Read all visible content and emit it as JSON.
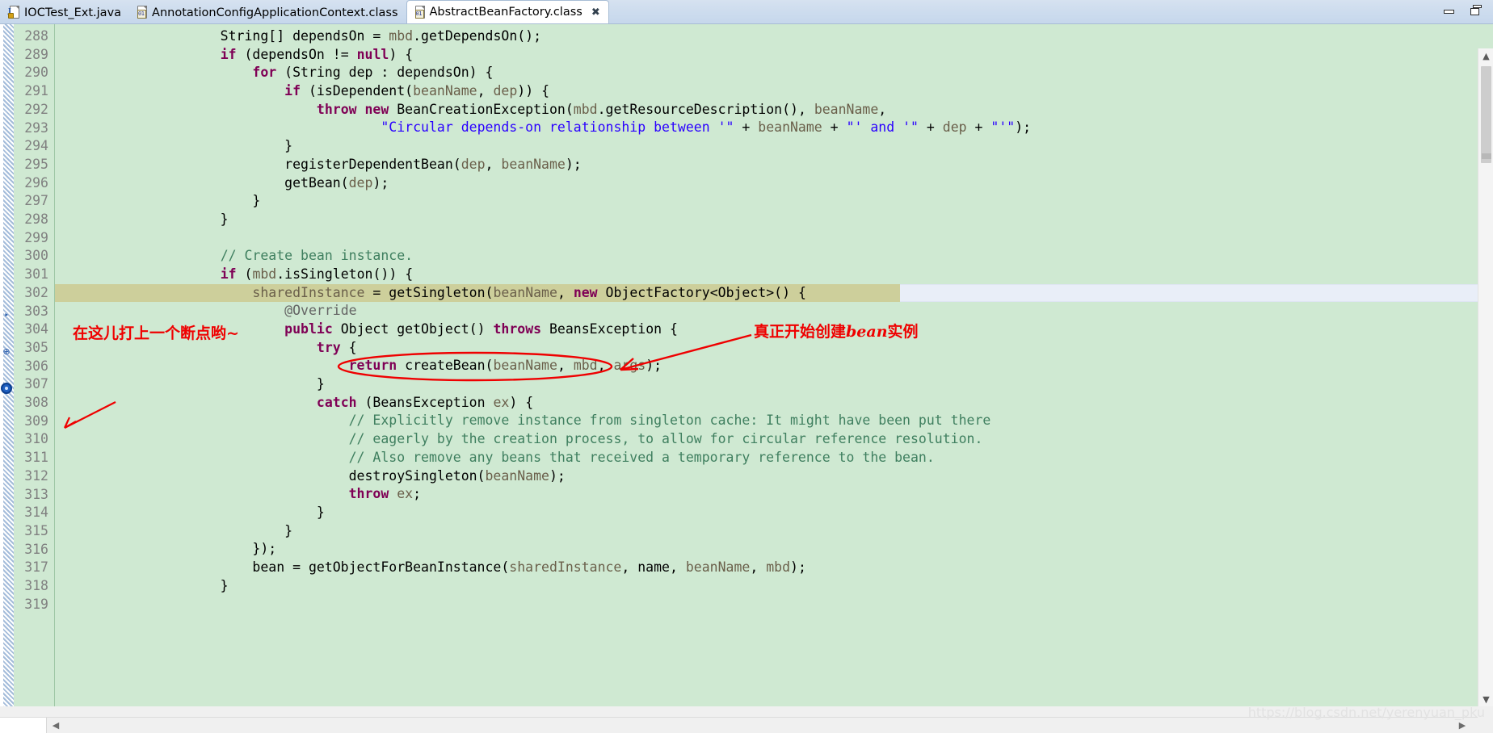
{
  "window": {
    "minimize_label": "Minimize",
    "restore_label": "Restore"
  },
  "tabs": [
    {
      "label": "IOCTest_Ext.java",
      "icon": "java-file-icon",
      "active": false,
      "closable": false
    },
    {
      "label": "AnnotationConfigApplicationContext.class",
      "icon": "class-file-icon",
      "active": false,
      "closable": false
    },
    {
      "label": "AbstractBeanFactory.class",
      "icon": "class-file-icon",
      "active": true,
      "closable": true,
      "close_glyph": "✖"
    }
  ],
  "editor": {
    "first_line_number": 288,
    "current_line": 302,
    "breakpoint_line": 306,
    "lines": [
      {
        "n": 288,
        "tokens": [
          {
            "t": "pln",
            "s": "                    String[] dependsOn = "
          },
          {
            "t": "var",
            "s": "mbd"
          },
          {
            "t": "pln",
            "s": ".getDependsOn();"
          }
        ]
      },
      {
        "n": 289,
        "tokens": [
          {
            "t": "pln",
            "s": "                    "
          },
          {
            "t": "kw",
            "s": "if"
          },
          {
            "t": "pln",
            "s": " (dependsOn != "
          },
          {
            "t": "kw",
            "s": "null"
          },
          {
            "t": "pln",
            "s": ") {"
          }
        ]
      },
      {
        "n": 290,
        "tokens": [
          {
            "t": "pln",
            "s": "                        "
          },
          {
            "t": "kw",
            "s": "for"
          },
          {
            "t": "pln",
            "s": " (String dep : dependsOn) {"
          }
        ]
      },
      {
        "n": 291,
        "tokens": [
          {
            "t": "pln",
            "s": "                            "
          },
          {
            "t": "kw",
            "s": "if"
          },
          {
            "t": "pln",
            "s": " (isDependent("
          },
          {
            "t": "par",
            "s": "beanName"
          },
          {
            "t": "pln",
            "s": ", "
          },
          {
            "t": "par",
            "s": "dep"
          },
          {
            "t": "pln",
            "s": ")) {"
          }
        ]
      },
      {
        "n": 292,
        "tokens": [
          {
            "t": "pln",
            "s": "                                "
          },
          {
            "t": "kw",
            "s": "throw new"
          },
          {
            "t": "pln",
            "s": " BeanCreationException("
          },
          {
            "t": "par",
            "s": "mbd"
          },
          {
            "t": "pln",
            "s": ".getResourceDescription(), "
          },
          {
            "t": "par",
            "s": "beanName"
          },
          {
            "t": "pln",
            "s": ","
          }
        ]
      },
      {
        "n": 293,
        "tokens": [
          {
            "t": "pln",
            "s": "                                        "
          },
          {
            "t": "str",
            "s": "\"Circular depends-on relationship between '\""
          },
          {
            "t": "pln",
            "s": " + "
          },
          {
            "t": "par",
            "s": "beanName"
          },
          {
            "t": "pln",
            "s": " + "
          },
          {
            "t": "str",
            "s": "\"' and '\""
          },
          {
            "t": "pln",
            "s": " + "
          },
          {
            "t": "par",
            "s": "dep"
          },
          {
            "t": "pln",
            "s": " + "
          },
          {
            "t": "str",
            "s": "\"'\""
          },
          {
            "t": "pln",
            "s": ");"
          }
        ]
      },
      {
        "n": 294,
        "tokens": [
          {
            "t": "pln",
            "s": "                            }"
          }
        ]
      },
      {
        "n": 295,
        "tokens": [
          {
            "t": "pln",
            "s": "                            registerDependentBean("
          },
          {
            "t": "par",
            "s": "dep"
          },
          {
            "t": "pln",
            "s": ", "
          },
          {
            "t": "par",
            "s": "beanName"
          },
          {
            "t": "pln",
            "s": ");"
          }
        ]
      },
      {
        "n": 296,
        "tokens": [
          {
            "t": "pln",
            "s": "                            getBean("
          },
          {
            "t": "par",
            "s": "dep"
          },
          {
            "t": "pln",
            "s": ");"
          }
        ]
      },
      {
        "n": 297,
        "tokens": [
          {
            "t": "pln",
            "s": "                        }"
          }
        ]
      },
      {
        "n": 298,
        "tokens": [
          {
            "t": "pln",
            "s": "                    }"
          }
        ]
      },
      {
        "n": 299,
        "tokens": [
          {
            "t": "pln",
            "s": ""
          }
        ]
      },
      {
        "n": 300,
        "tokens": [
          {
            "t": "pln",
            "s": "                    "
          },
          {
            "t": "cmt",
            "s": "// Create bean instance."
          }
        ]
      },
      {
        "n": 301,
        "tokens": [
          {
            "t": "pln",
            "s": "                    "
          },
          {
            "t": "kw",
            "s": "if"
          },
          {
            "t": "pln",
            "s": " ("
          },
          {
            "t": "par",
            "s": "mbd"
          },
          {
            "t": "pln",
            "s": ".isSingleton()) {"
          }
        ]
      },
      {
        "n": 302,
        "tokens": [
          {
            "t": "pln",
            "s": "                        "
          },
          {
            "t": "par",
            "s": "sharedInstance"
          },
          {
            "t": "pln",
            "s": " = getSingleton("
          },
          {
            "t": "par",
            "s": "beanName"
          },
          {
            "t": "pln",
            "s": ", "
          },
          {
            "t": "kw",
            "s": "new"
          },
          {
            "t": "pln",
            "s": " ObjectFactory<Object>() {"
          }
        ]
      },
      {
        "n": 303,
        "tokens": [
          {
            "t": "pln",
            "s": "                            "
          },
          {
            "t": "ann",
            "s": "@Override"
          }
        ]
      },
      {
        "n": 304,
        "tokens": [
          {
            "t": "pln",
            "s": "                            "
          },
          {
            "t": "kw",
            "s": "public"
          },
          {
            "t": "pln",
            "s": " Object getObject() "
          },
          {
            "t": "kw",
            "s": "throws"
          },
          {
            "t": "pln",
            "s": " BeansException {"
          }
        ]
      },
      {
        "n": 305,
        "tokens": [
          {
            "t": "pln",
            "s": "                                "
          },
          {
            "t": "kw",
            "s": "try"
          },
          {
            "t": "pln",
            "s": " {"
          }
        ]
      },
      {
        "n": 306,
        "tokens": [
          {
            "t": "pln",
            "s": "                                    "
          },
          {
            "t": "kw",
            "s": "return"
          },
          {
            "t": "pln",
            "s": " createBean("
          },
          {
            "t": "par",
            "s": "beanName"
          },
          {
            "t": "pln",
            "s": ", "
          },
          {
            "t": "par",
            "s": "mbd"
          },
          {
            "t": "pln",
            "s": ", "
          },
          {
            "t": "par",
            "s": "args"
          },
          {
            "t": "pln",
            "s": ");"
          }
        ]
      },
      {
        "n": 307,
        "tokens": [
          {
            "t": "pln",
            "s": "                                }"
          }
        ]
      },
      {
        "n": 308,
        "tokens": [
          {
            "t": "pln",
            "s": "                                "
          },
          {
            "t": "kw",
            "s": "catch"
          },
          {
            "t": "pln",
            "s": " (BeansException "
          },
          {
            "t": "par",
            "s": "ex"
          },
          {
            "t": "pln",
            "s": ") {"
          }
        ]
      },
      {
        "n": 309,
        "tokens": [
          {
            "t": "pln",
            "s": "                                    "
          },
          {
            "t": "cmt",
            "s": "// Explicitly remove instance from singleton cache: It might have been put there"
          }
        ]
      },
      {
        "n": 310,
        "tokens": [
          {
            "t": "pln",
            "s": "                                    "
          },
          {
            "t": "cmt",
            "s": "// eagerly by the creation process, to allow for circular reference resolution."
          }
        ]
      },
      {
        "n": 311,
        "tokens": [
          {
            "t": "pln",
            "s": "                                    "
          },
          {
            "t": "cmt",
            "s": "// Also remove any beans that received a temporary reference to the bean."
          }
        ]
      },
      {
        "n": 312,
        "tokens": [
          {
            "t": "pln",
            "s": "                                    destroySingleton("
          },
          {
            "t": "par",
            "s": "beanName"
          },
          {
            "t": "pln",
            "s": ");"
          }
        ]
      },
      {
        "n": 313,
        "tokens": [
          {
            "t": "pln",
            "s": "                                    "
          },
          {
            "t": "kw",
            "s": "throw"
          },
          {
            "t": "pln",
            "s": " "
          },
          {
            "t": "par",
            "s": "ex"
          },
          {
            "t": "pln",
            "s": ";"
          }
        ]
      },
      {
        "n": 314,
        "tokens": [
          {
            "t": "pln",
            "s": "                                }"
          }
        ]
      },
      {
        "n": 315,
        "tokens": [
          {
            "t": "pln",
            "s": "                            }"
          }
        ]
      },
      {
        "n": 316,
        "tokens": [
          {
            "t": "pln",
            "s": "                        });"
          }
        ]
      },
      {
        "n": 317,
        "tokens": [
          {
            "t": "pln",
            "s": "                        bean = getObjectForBeanInstance("
          },
          {
            "t": "par",
            "s": "sharedInstance"
          },
          {
            "t": "pln",
            "s": ", name, "
          },
          {
            "t": "par",
            "s": "beanName"
          },
          {
            "t": "pln",
            "s": ", "
          },
          {
            "t": "par",
            "s": "mbd"
          },
          {
            "t": "pln",
            "s": ");"
          }
        ]
      },
      {
        "n": 318,
        "tokens": [
          {
            "t": "pln",
            "s": "                    }"
          }
        ]
      },
      {
        "n": 319,
        "tokens": [
          {
            "t": "pln",
            "s": ""
          }
        ]
      }
    ]
  },
  "annotations": [
    {
      "id": "breakpoint-note",
      "text": "在这儿打上一个断点哟~",
      "color": "#ef0000"
    },
    {
      "id": "createbean-note",
      "text_prefix": "真正开始创建",
      "text_em": "bean",
      "text_suffix": "实例",
      "color": "#ef0000"
    }
  ],
  "colors": {
    "method_block_bg": "#cfe9d2",
    "current_line_bg": "#cdcf9b",
    "selection_bg": "#e9eef8",
    "gutter_text": "#808080",
    "annotation_red": "#ef0000",
    "tabbar_bg": "#cddcee"
  },
  "scrollbars": {
    "vertical_up_glyph": "▲",
    "vertical_down_glyph": "▼",
    "horizontal_left_glyph": "◀",
    "horizontal_right_glyph": "▶"
  },
  "watermark": {
    "text": "https://blog.csdn.net/yerenyuan_pku"
  }
}
